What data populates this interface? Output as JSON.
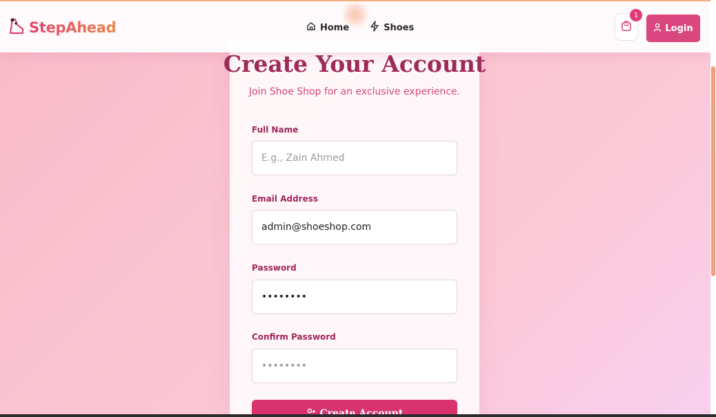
{
  "brand": {
    "name": "StepAhead"
  },
  "nav": {
    "home": "Home",
    "shoes": "Shoes"
  },
  "cart": {
    "count": "1"
  },
  "login": {
    "label": "Login"
  },
  "form": {
    "title": "Create Your Account",
    "subtitle": "Join Shoe Shop for an exclusive experience.",
    "full_name": {
      "label": "Full Name",
      "placeholder": "E.g., Zain Ahmed",
      "value": ""
    },
    "email": {
      "label": "Email Address",
      "value": "admin@shoeshop.com"
    },
    "password": {
      "label": "Password",
      "value": "••••••••"
    },
    "confirm_password": {
      "label": "Confirm Password",
      "placeholder": "••••••••",
      "value": ""
    },
    "submit": "Create Account"
  },
  "icons": {
    "brand": "shoe-logo-icon",
    "home": "home-icon",
    "shoes": "lightning-icon",
    "cart": "shopping-bag-icon",
    "login": "user-icon",
    "submit": "user-plus-icon"
  },
  "colors": {
    "accent": "#d9477e",
    "title": "#9e2a58",
    "scrollbar": "#f0a07a"
  }
}
